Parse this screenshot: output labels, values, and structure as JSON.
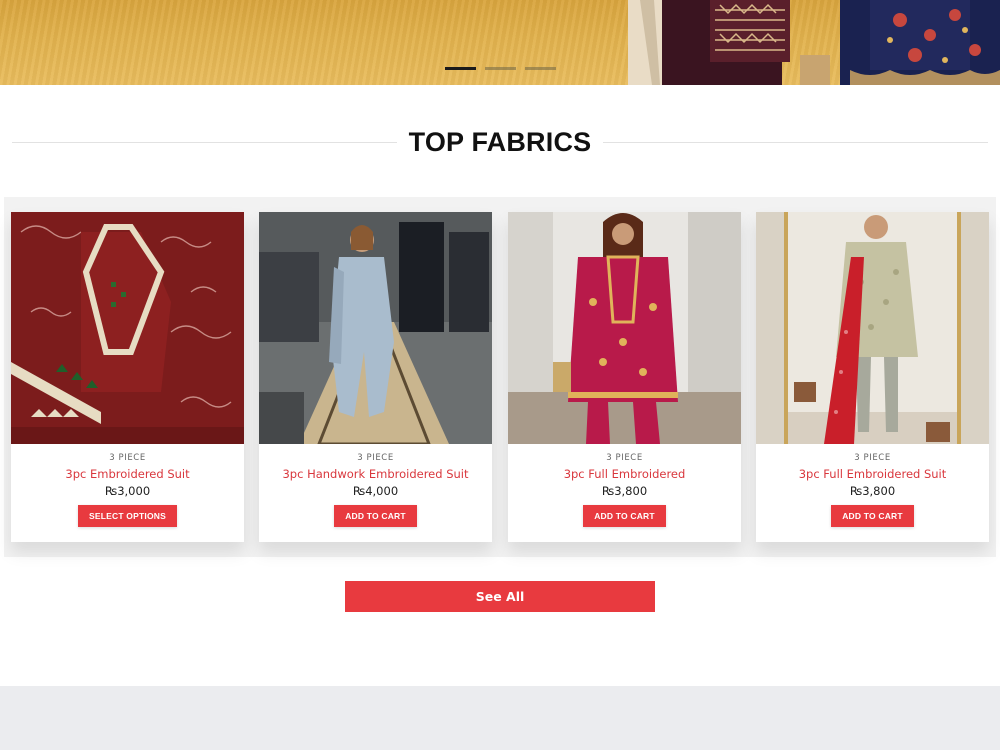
{
  "hero": {
    "slides": [
      {
        "label": "slide-1",
        "active": true
      },
      {
        "label": "slide-2",
        "active": false
      },
      {
        "label": "slide-3",
        "active": false
      }
    ],
    "colors": {
      "background": "#e2b24d",
      "active_dot": "#1b1b1b"
    }
  },
  "section": {
    "title": "TOP FABRICS"
  },
  "products": [
    {
      "category": "3 PIECE",
      "title": "3pc Embroidered Suit",
      "price": "₨3,000",
      "button": "SELECT OPTIONS"
    },
    {
      "category": "3 PIECE",
      "title": "3pc Handwork Embroidered Suit",
      "price": "₨4,000",
      "button": "ADD TO CART"
    },
    {
      "category": "3 PIECE",
      "title": "3pc Full Embroidered",
      "price": "₨3,800",
      "button": "ADD TO CART"
    },
    {
      "category": "3 PIECE",
      "title": "3pc Full Embroidered Suit",
      "price": "₨3,800",
      "button": "ADD TO CART"
    }
  ],
  "see_all": {
    "label": "See All"
  },
  "theme": {
    "accent": "#e83a3f",
    "title_red": "#d9373d",
    "footer_bg": "#ebecef"
  }
}
